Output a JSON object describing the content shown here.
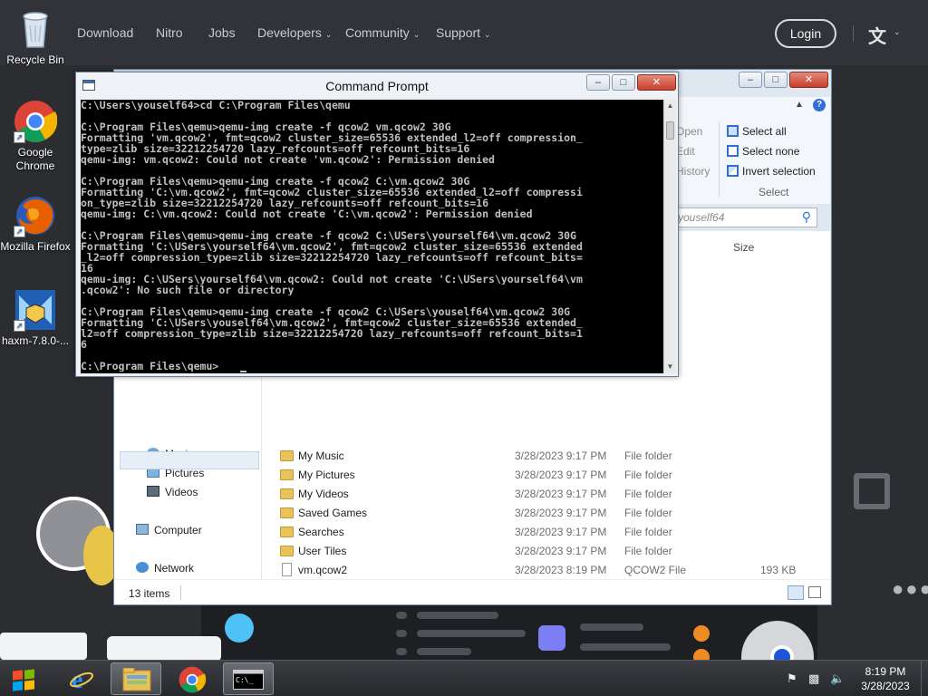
{
  "website": {
    "nav": [
      {
        "label": "Download",
        "has_menu": false
      },
      {
        "label": "Nitro",
        "has_menu": false
      },
      {
        "label": "Jobs",
        "has_menu": false
      },
      {
        "label": "Developers",
        "has_menu": true
      },
      {
        "label": "Community",
        "has_menu": true
      },
      {
        "label": "Support",
        "has_menu": true
      }
    ],
    "login_label": "Login",
    "language_icon": "translate-icon"
  },
  "desktop": {
    "icons": [
      {
        "label": "Recycle Bin",
        "icon": "recycle-bin-icon"
      },
      {
        "label": "Google Chrome",
        "icon": "chrome-icon"
      },
      {
        "label": "Mozilla Firefox",
        "icon": "firefox-icon"
      },
      {
        "label": "haxm-7.8.0-...",
        "icon": "haxm-installer-icon"
      }
    ]
  },
  "explorer": {
    "ribbon": {
      "select_all": "Select all",
      "select_none": "Select none",
      "invert_selection": "Invert selection",
      "group_label": "Select",
      "faded_open": "Open",
      "faded_edit": "Edit",
      "faded_history": "History"
    },
    "search_text": "youself64",
    "column_size": "Size",
    "nav_pane": {
      "music": "Music",
      "pictures": "Pictures",
      "videos": "Videos",
      "computer": "Computer",
      "network": "Network"
    },
    "files": [
      {
        "name": "My Music",
        "date": "3/28/2023 9:17 PM",
        "type": "File folder",
        "size": "",
        "kind": "folder"
      },
      {
        "name": "My Pictures",
        "date": "3/28/2023 9:17 PM",
        "type": "File folder",
        "size": "",
        "kind": "folder"
      },
      {
        "name": "My Videos",
        "date": "3/28/2023 9:17 PM",
        "type": "File folder",
        "size": "",
        "kind": "folder"
      },
      {
        "name": "Saved Games",
        "date": "3/28/2023 9:17 PM",
        "type": "File folder",
        "size": "",
        "kind": "folder"
      },
      {
        "name": "Searches",
        "date": "3/28/2023 9:17 PM",
        "type": "File folder",
        "size": "",
        "kind": "folder"
      },
      {
        "name": "User Tiles",
        "date": "3/28/2023 9:17 PM",
        "type": "File folder",
        "size": "",
        "kind": "folder"
      },
      {
        "name": "vm.qcow2",
        "date": "3/28/2023 8:19 PM",
        "type": "QCOW2 File",
        "size": "193 KB",
        "kind": "file"
      }
    ],
    "status_count": "13 items"
  },
  "cmd": {
    "title": "Command Prompt",
    "lines": [
      "C:\\Users\\youself64>cd C:\\Program Files\\qemu",
      "",
      "C:\\Program Files\\qemu>qemu-img create -f qcow2 vm.qcow2 30G",
      "Formatting 'vm.qcow2', fmt=qcow2 cluster_size=65536 extended_l2=off compression_",
      "type=zlib size=32212254720 lazy_refcounts=off refcount_bits=16",
      "qemu-img: vm.qcow2: Could not create 'vm.qcow2': Permission denied",
      "",
      "C:\\Program Files\\qemu>qemu-img create -f qcow2 C:\\vm.qcow2 30G",
      "Formatting 'C:\\vm.qcow2', fmt=qcow2 cluster_size=65536 extended_l2=off compressi",
      "on_type=zlib size=32212254720 lazy_refcounts=off refcount_bits=16",
      "qemu-img: C:\\vm.qcow2: Could not create 'C:\\vm.qcow2': Permission denied",
      "",
      "C:\\Program Files\\qemu>qemu-img create -f qcow2 C:\\USers\\yourself64\\vm.qcow2 30G",
      "Formatting 'C:\\USers\\yourself64\\vm.qcow2', fmt=qcow2 cluster_size=65536 extended",
      "_l2=off compression_type=zlib size=32212254720 lazy_refcounts=off refcount_bits=",
      "16",
      "qemu-img: C:\\USers\\yourself64\\vm.qcow2: Could not create 'C:\\USers\\yourself64\\vm",
      ".qcow2': No such file or directory",
      "",
      "C:\\Program Files\\qemu>qemu-img create -f qcow2 C:\\USers\\youself64\\vm.qcow2 30G",
      "Formatting 'C:\\USers\\youself64\\vm.qcow2', fmt=qcow2 cluster_size=65536 extended_",
      "l2=off compression_type=zlib size=32212254720 lazy_refcounts=off refcount_bits=1",
      "6",
      "",
      "C:\\Program Files\\qemu>"
    ]
  },
  "taskbar": {
    "pinned": [
      {
        "icon": "internet-explorer-icon",
        "active": false
      },
      {
        "icon": "file-explorer-icon",
        "active": true
      },
      {
        "icon": "chrome-icon",
        "active": false
      },
      {
        "icon": "command-prompt-icon",
        "active": true
      }
    ],
    "clock_time": "8:19 PM",
    "clock_date": "3/28/2023"
  }
}
